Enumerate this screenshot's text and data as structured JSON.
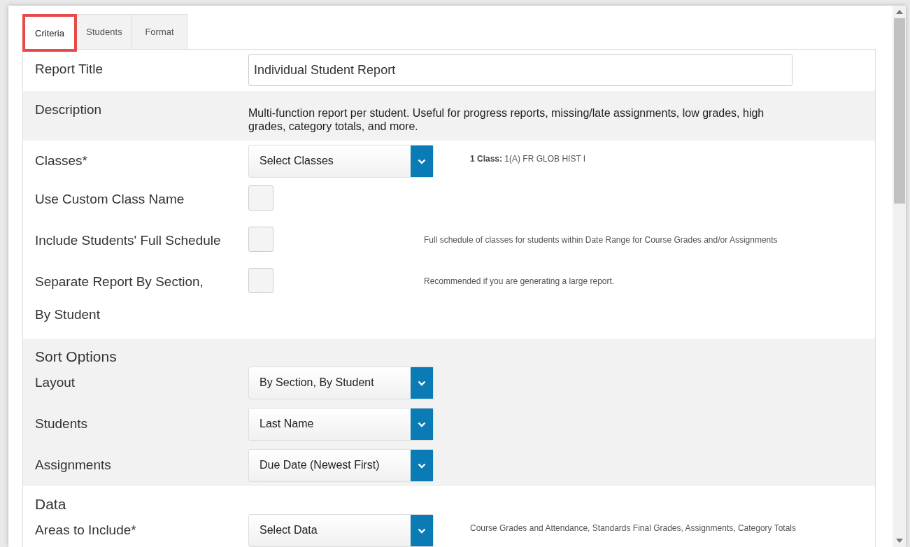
{
  "tabs": [
    {
      "label": "Criteria",
      "selected": true,
      "highlighted": true
    },
    {
      "label": "Students",
      "selected": false,
      "highlighted": false
    },
    {
      "label": "Format",
      "selected": false,
      "highlighted": false
    }
  ],
  "sections": [
    {
      "shaded": false,
      "rows": [
        {
          "kind": "text",
          "label": "Report Title",
          "value": "Individual Student Report"
        }
      ]
    },
    {
      "shaded": true,
      "rows": [
        {
          "kind": "description",
          "label": "Description",
          "text": "Multi-function report per student. Useful for progress reports, missing/late assignments, low grades, high grades, category totals, and more."
        }
      ]
    },
    {
      "shaded": false,
      "rows": [
        {
          "kind": "select",
          "label": "Classes*",
          "value": "Select Classes",
          "note": "**1 Class:** 1(A) FR GLOB HIST I"
        },
        {
          "kind": "checkbox",
          "label": "Use Custom Class Name",
          "checked": false
        },
        {
          "kind": "checkbox",
          "label": "Include Students' Full Schedule",
          "checked": false,
          "note": "Full schedule of classes for students within Date Range for Course Grades and/or Assignments"
        },
        {
          "kind": "checkbox",
          "label": "Separate Report By Section, By Student",
          "checked": false,
          "note": "Recommended if you are generating a large report."
        }
      ]
    },
    {
      "shaded": true,
      "heading": "Sort Options",
      "rows": [
        {
          "kind": "select",
          "label": "Layout",
          "value": "By Section, By Student"
        },
        {
          "kind": "select",
          "label": "Students",
          "value": "Last Name"
        },
        {
          "kind": "select",
          "label": "Assignments",
          "value": "Due Date (Newest First)"
        }
      ]
    },
    {
      "shaded": false,
      "heading": "Data",
      "rows": [
        {
          "kind": "select",
          "label": "Areas to Include*",
          "value": "Select Data",
          "note": "Course Grades and Attendance, Standards Final Grades, Assignments, Category Totals"
        }
      ]
    }
  ]
}
